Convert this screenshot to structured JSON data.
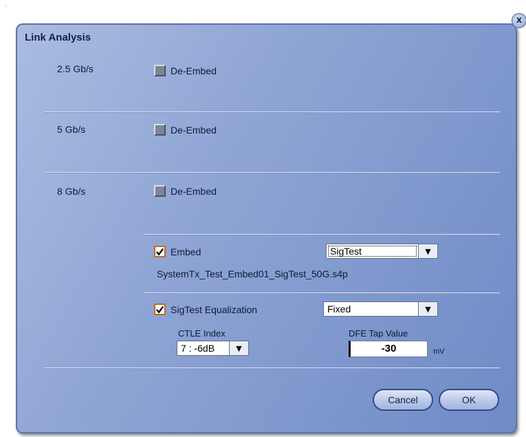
{
  "dialog": {
    "title": "Link Analysis",
    "close_label": "x"
  },
  "rates": [
    {
      "label": "2.5 Gb/s",
      "checkbox_label": "De-Embed",
      "checked": false
    },
    {
      "label": "5 Gb/s",
      "checkbox_label": "De-Embed",
      "checked": false
    },
    {
      "label": "8 Gb/s",
      "checkbox_label": "De-Embed",
      "checked": false
    }
  ],
  "embed": {
    "label": "Embed",
    "checked": true,
    "select_value": "SigTest",
    "file_name": "SystemTx_Test_Embed01_SigTest_50G.s4p"
  },
  "equalization": {
    "label": "SigTest Equalization",
    "checked": true,
    "select_value": "Fixed",
    "ctle_label": "CTLE Index",
    "ctle_value": "7 : -6dB",
    "dfe_label": "DFE Tap Value",
    "dfe_value": "-30",
    "dfe_unit": "mV"
  },
  "buttons": {
    "cancel": "Cancel",
    "ok": "OK"
  },
  "colors": {
    "dialog_gradient_start": "#aabce0",
    "dialog_gradient_end": "#6f8bc6",
    "checkbox_accent": "#c46a1a"
  }
}
